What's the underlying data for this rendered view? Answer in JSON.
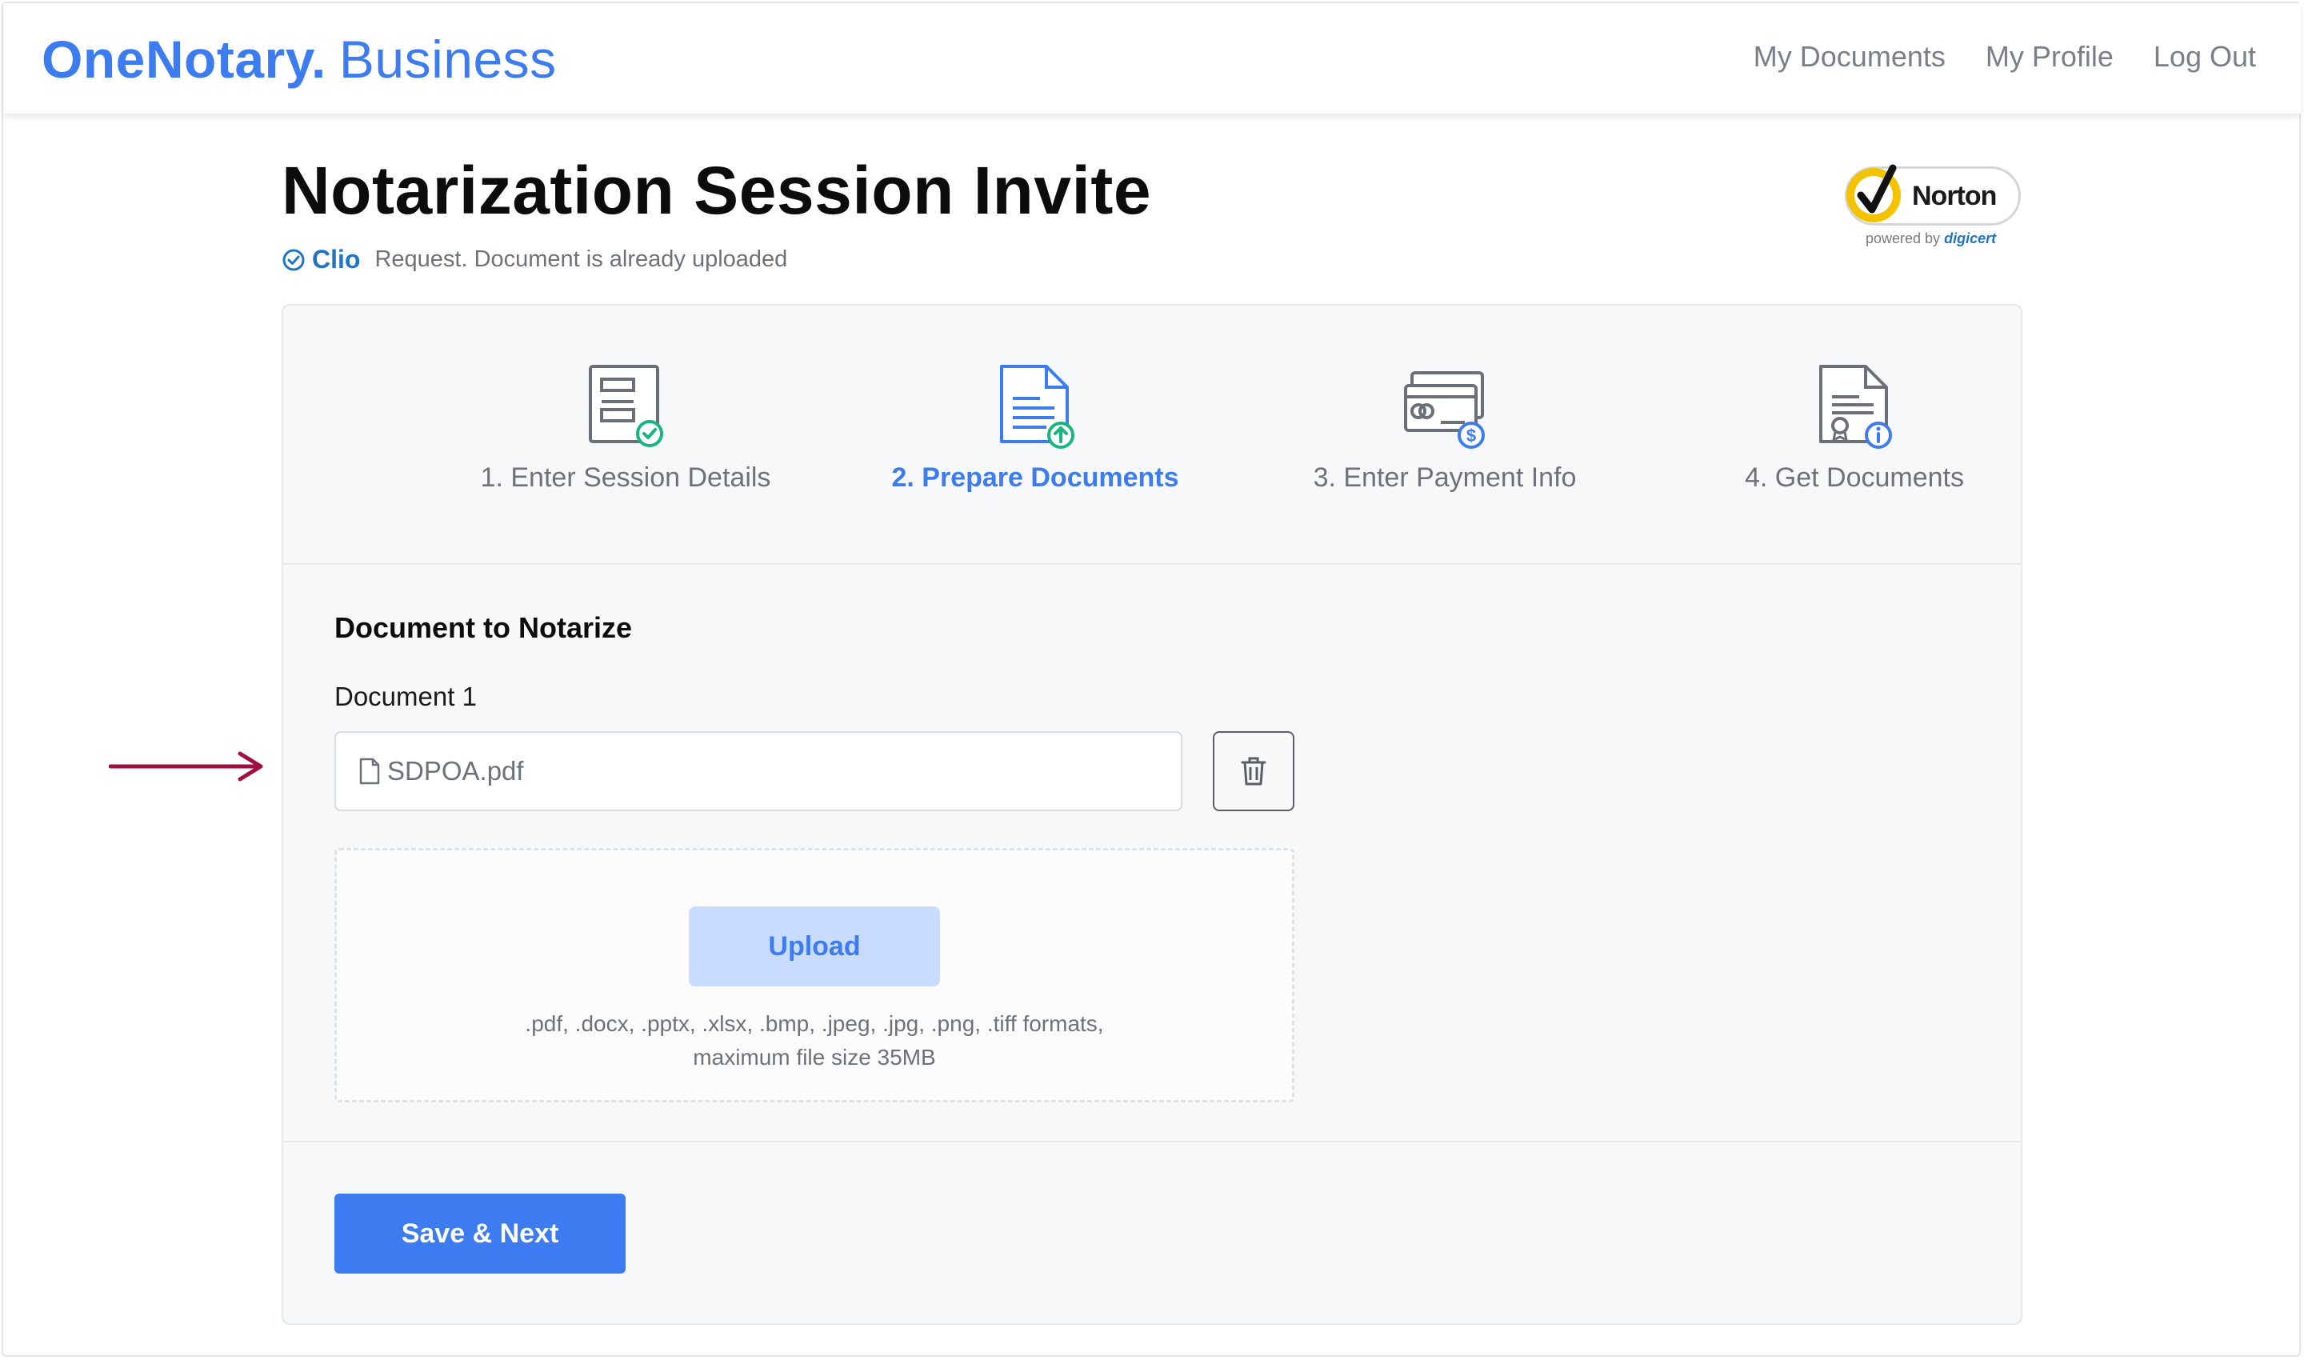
{
  "header": {
    "brand_primary": "OneNotary.",
    "brand_secondary": "Business",
    "nav": [
      "My Documents",
      "My Profile",
      "Log Out"
    ]
  },
  "page": {
    "title": "Notarization Session Invite",
    "source_brand": "Clio",
    "subtitle": "Request. Document is already uploaded"
  },
  "badge": {
    "name": "Norton",
    "powered_by": "powered by",
    "partner": "digicert"
  },
  "steps": [
    {
      "label": "1. Enter Session Details",
      "icon": "document-check-icon",
      "state": "done"
    },
    {
      "label": "2. Prepare Documents",
      "icon": "document-upload-icon",
      "state": "active"
    },
    {
      "label": "3. Enter Payment Info",
      "icon": "payment-card-icon",
      "state": "pending"
    },
    {
      "label": "4. Get Documents",
      "icon": "certificate-info-icon",
      "state": "pending"
    }
  ],
  "form": {
    "section_title": "Document to Notarize",
    "document_label": "Document 1",
    "file_name": "SDPOA.pdf",
    "upload_label": "Upload",
    "hint_line1": ".pdf, .docx, .pptx, .xlsx, .bmp, .jpeg, .jpg, .png, .tiff formats,",
    "hint_line2": "maximum file size 35MB",
    "save_label": "Save & Next"
  },
  "colors": {
    "accent": "#3c7cf0",
    "accent_light": "#c9dbff",
    "success": "#17b67e",
    "arrow": "#a0103c"
  }
}
